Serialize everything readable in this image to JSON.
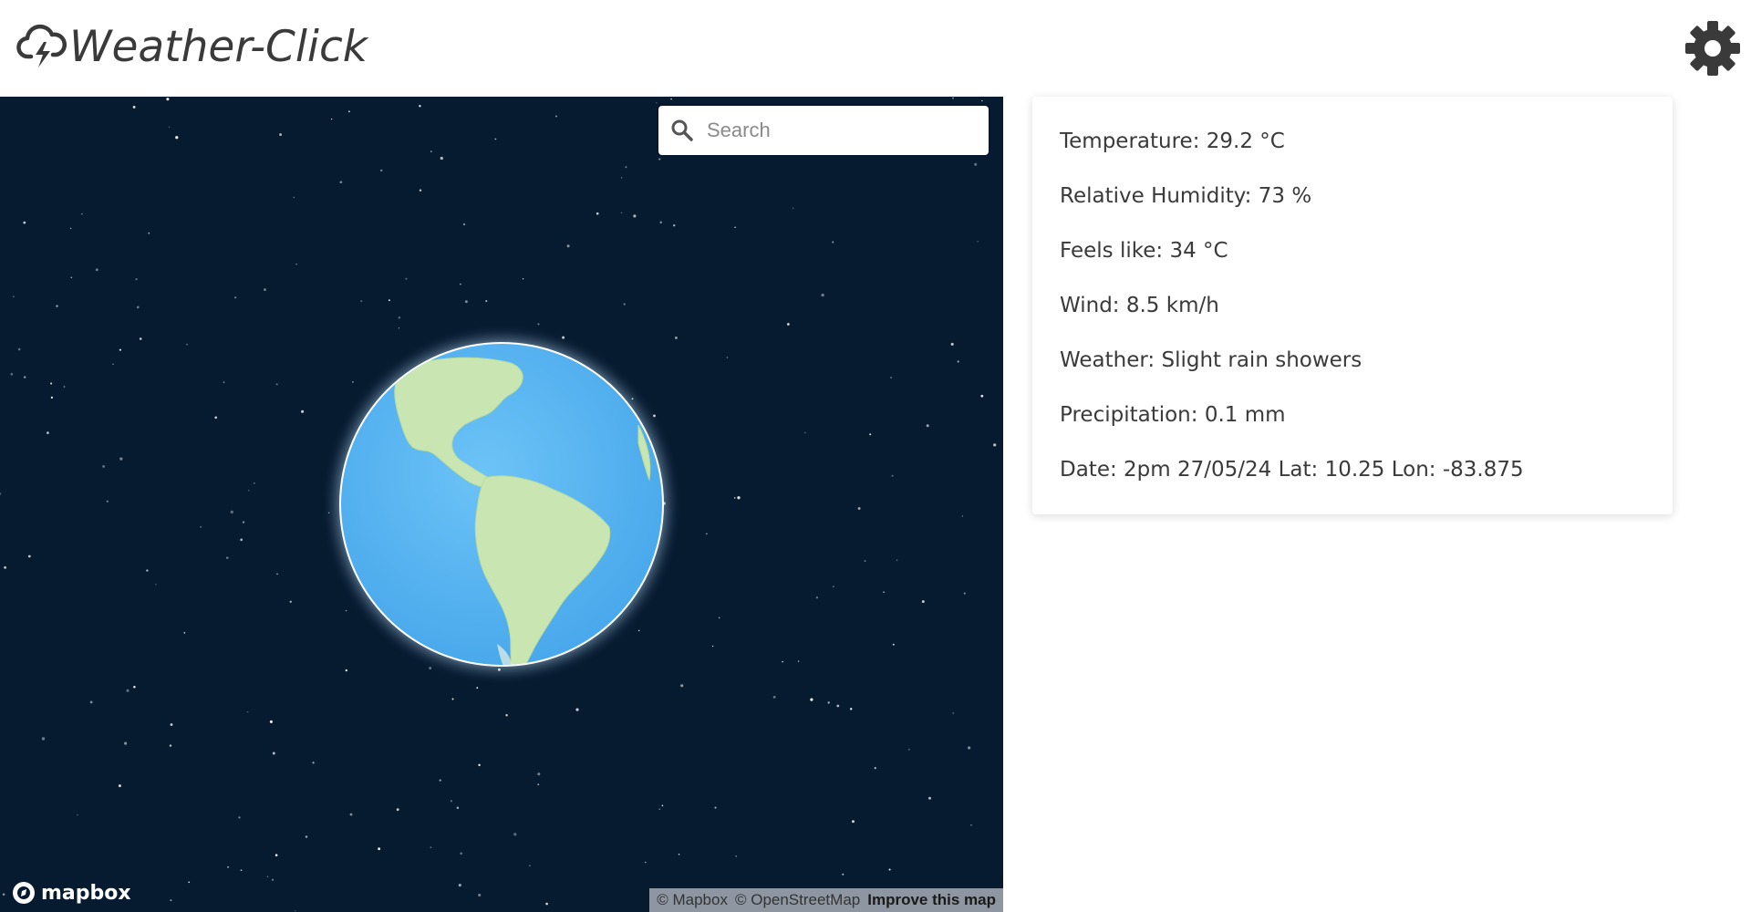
{
  "app": {
    "title": "Weather-Click",
    "logo_icon": "cloud-lightning-icon",
    "settings_icon": "gear-icon"
  },
  "map": {
    "search_placeholder": "Search",
    "search_icon": "magnifier-icon",
    "brand": "mapbox",
    "attribution": {
      "mapbox": "© Mapbox",
      "osm": "© OpenStreetMap",
      "improve": "Improve this map"
    },
    "colors": {
      "space": "#061a30",
      "ocean": "#56b6f2",
      "land": "#c8e4b0"
    }
  },
  "weather": {
    "rows": [
      "Temperature: 29.2 °C",
      "Relative Humidity: 73 %",
      "Feels like: 34 °C",
      "Wind: 8.5 km/h",
      "Weather: Slight rain showers",
      "Precipitation: 0.1 mm",
      "Date: 2pm 27/05/24 Lat: 10.25 Lon: -83.875"
    ]
  }
}
